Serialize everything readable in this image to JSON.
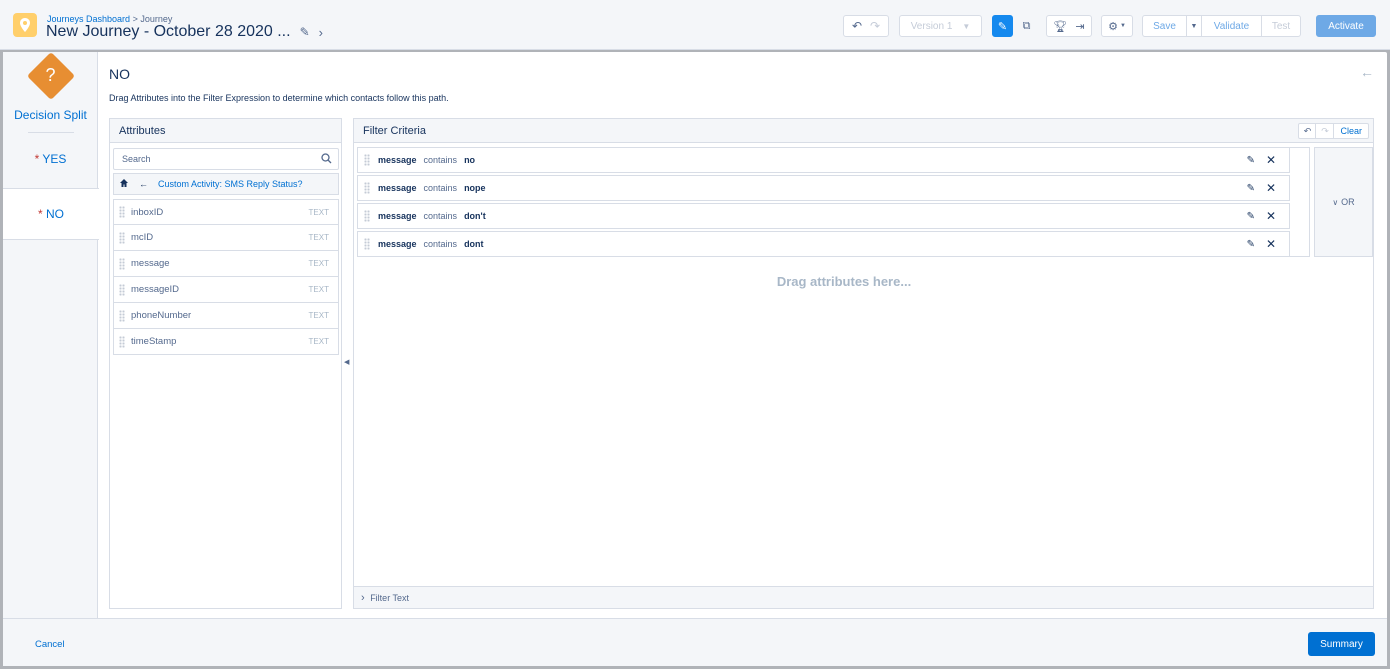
{
  "header": {
    "breadcrumb_link": "Journeys Dashboard",
    "breadcrumb_sep": " > ",
    "breadcrumb_current": "Journey",
    "title": "New Journey - October 28 2020 ...",
    "version_label": "Version 1",
    "save_label": "Save",
    "validate_label": "Validate",
    "test_label": "Test",
    "activate_label": "Activate"
  },
  "left_nav": {
    "activity_label": "Decision Split",
    "paths": [
      {
        "label": "YES",
        "required_mark": "*"
      },
      {
        "label": "NO",
        "required_mark": "*"
      }
    ]
  },
  "content": {
    "title": "NO",
    "description": "Drag Attributes into the Filter Expression to determine which contacts follow this path."
  },
  "attributes": {
    "header": "Attributes",
    "search_placeholder": "Search",
    "current_source": "Custom Activity: SMS Reply Status?",
    "items": [
      {
        "name": "inboxID",
        "type": "TEXT"
      },
      {
        "name": "mcID",
        "type": "TEXT"
      },
      {
        "name": "message",
        "type": "TEXT"
      },
      {
        "name": "messageID",
        "type": "TEXT"
      },
      {
        "name": "phoneNumber",
        "type": "TEXT"
      },
      {
        "name": "timeStamp",
        "type": "TEXT"
      }
    ]
  },
  "filter": {
    "header": "Filter Criteria",
    "clear_label": "Clear",
    "criteria": [
      {
        "attribute": "message",
        "operator": "contains",
        "value": "no"
      },
      {
        "attribute": "message",
        "operator": "contains",
        "value": "nope"
      },
      {
        "attribute": "message",
        "operator": "contains",
        "value": "don't"
      },
      {
        "attribute": "message",
        "operator": "contains",
        "value": "dont"
      }
    ],
    "logic_label": "OR",
    "drop_hint": "Drag attributes here...",
    "filter_text_label": "Filter Text"
  },
  "footer": {
    "cancel_label": "Cancel",
    "summary_label": "Summary"
  },
  "colors": {
    "brand_blue": "#0070d2",
    "decision_orange": "#e78e32",
    "journey_icon_yellow": "#ffcf6b"
  }
}
